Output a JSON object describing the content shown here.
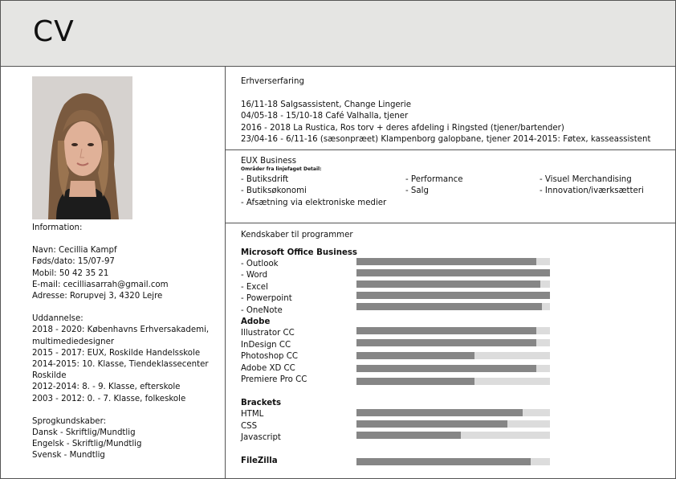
{
  "header": {
    "title": "CV"
  },
  "sidebar": {
    "info_heading": "Information:",
    "info": [
      "Navn: Cecillia Kampf",
      "Føds/dato: 15/07-97",
      "Mobil: 50 42 35 21",
      "E-mail: cecilliasarrah@gmail.com",
      "Adresse: Rorupvej 3, 4320 Lejre"
    ],
    "education_heading": "Uddannelse:",
    "education": [
      "2018 - 2020: Københavns Erhversakademi,",
      "multimediedesigner",
      "2015 - 2017: EUX, Roskilde Handelsskole",
      "2014-2015: 10. Klasse, Tiendeklassecenter",
      "Roskilde",
      "2012-2014: 8. - 9. Klasse, efterskole",
      "2003 - 2012: 0. - 7. Klasse, folkeskole"
    ],
    "languages_heading": "Sprogkundskaber:",
    "languages": [
      "Dansk - Skriftlig/Mundtlig",
      "Engelsk - Skriftlig/Mundtlig",
      "Svensk - Mundtlig"
    ]
  },
  "experience": {
    "title": "Erhverserfaring",
    "items": [
      "16/11-18 Salgsassistent, Change Lingerie",
      "04/05-18 - 15/10-18 Café Valhalla, tjener",
      "2016 - 2018 La Rustica, Ros torv + deres afdeling i Ringsted (tjener/bartender)",
      "23/04-16 - 6/11-16 (sæsonpræet) Klampenborg galopbane, tjener 2014-2015: Føtex, kasseassistent"
    ]
  },
  "eux": {
    "title": "EUX Business",
    "subtitle": "Områder fra linjefaget Detail:",
    "items": [
      "- Butiksdrift",
      "- Performance",
      "- Visuel Merchandising",
      "- Butiksøkonomi",
      "- Salg",
      "- Innovation/iværksætteri",
      "- Afsætning via elektroniske medier"
    ]
  },
  "skills": {
    "title": "Kendskaber til programmer",
    "groups": [
      {
        "heading": "Microsoft Office Business"
      },
      {
        "heading": "Adobe"
      },
      {
        "heading": "Brackets"
      },
      {
        "heading": "FileZilla"
      }
    ],
    "items": [
      {
        "label": "- Outlook",
        "level": 0.93
      },
      {
        "label": "- Word",
        "level": 1.0
      },
      {
        "label": "- Excel",
        "level": 0.95
      },
      {
        "label": "- Powerpoint",
        "level": 1.0
      },
      {
        "label": "- OneNote",
        "level": 0.96
      },
      {
        "label": "Illustrator CC",
        "level": 0.93
      },
      {
        "label": "InDesign CC",
        "level": 0.93
      },
      {
        "label": "Photoshop CC",
        "level": 0.61
      },
      {
        "label": "Adobe XD CC",
        "level": 0.93
      },
      {
        "label": "Premiere Pro CC",
        "level": 0.61
      },
      {
        "label": "HTML",
        "level": 0.86
      },
      {
        "label": "CSS",
        "level": 0.78
      },
      {
        "label": "Javascript",
        "level": 0.54
      },
      {
        "label": "",
        "level": 0.9
      }
    ]
  },
  "colors": {
    "header_bg": "#e5e5e3",
    "bar_bg": "#dcdcdc",
    "bar_fill": "#868686"
  }
}
